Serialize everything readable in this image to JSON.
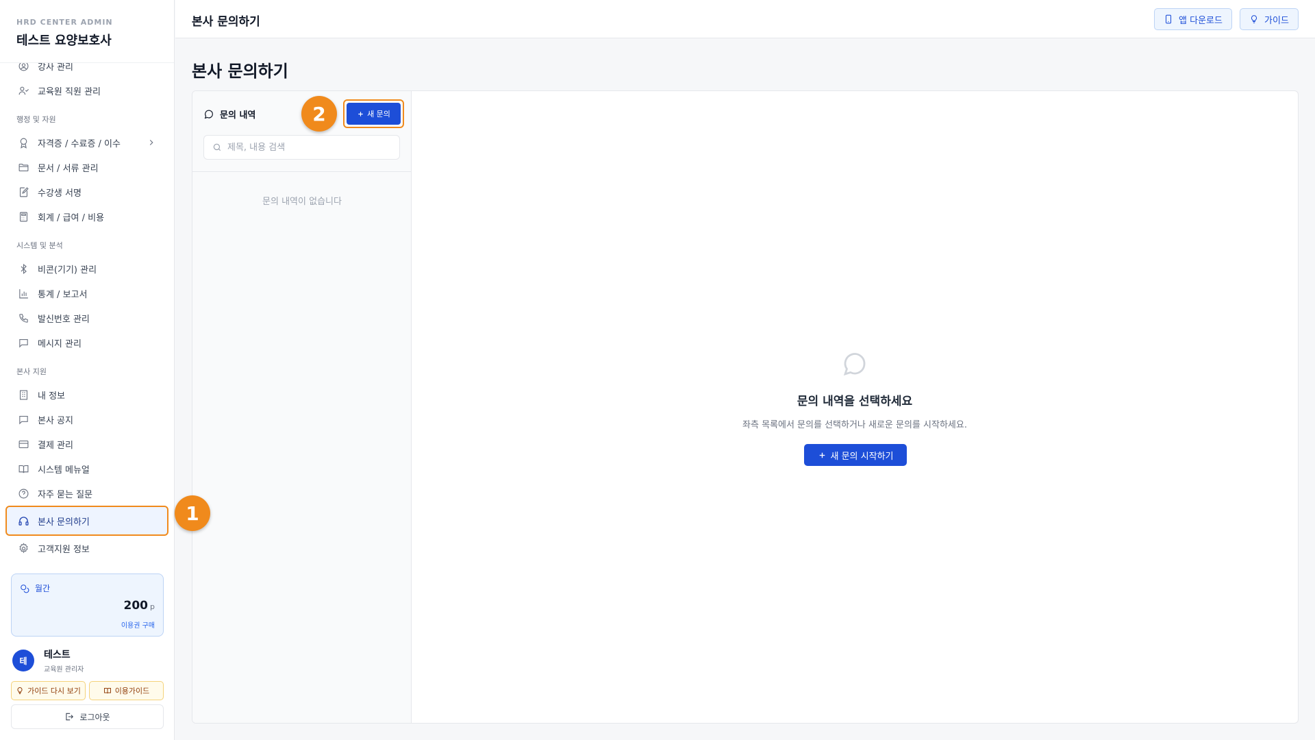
{
  "sidebar": {
    "brand_sub": "HRD CENTER ADMIN",
    "brand_title": "테스트 요양보호사",
    "items_top": [
      {
        "label": "강사 관리",
        "icon": "user-circle-icon"
      },
      {
        "label": "교육원 직원 관리",
        "icon": "users-icon"
      }
    ],
    "group_admin": "행정 및 자원",
    "items_admin": [
      {
        "label": "자격증 / 수료증 / 이수",
        "icon": "award-icon"
      },
      {
        "label": "문서 / 서류 관리",
        "icon": "folder-icon"
      },
      {
        "label": "수강생 서명",
        "icon": "signature-icon"
      },
      {
        "label": "회계 / 급여 / 비용",
        "icon": "calculator-icon"
      }
    ],
    "group_system": "시스템 및 분석",
    "items_system": [
      {
        "label": "비콘(기기) 관리",
        "icon": "bluetooth-icon"
      },
      {
        "label": "통계 / 보고서",
        "icon": "bar-chart-icon"
      },
      {
        "label": "발신번호 관리",
        "icon": "phone-icon"
      },
      {
        "label": "메시지 관리",
        "icon": "message-icon"
      }
    ],
    "group_support": "본사 지원",
    "items_support": [
      {
        "label": "내 정보",
        "icon": "building-icon"
      },
      {
        "label": "본사 공지",
        "icon": "message-icon"
      },
      {
        "label": "결제 관리",
        "icon": "credit-card-icon"
      },
      {
        "label": "시스템 메뉴얼",
        "icon": "book-icon"
      },
      {
        "label": "자주 묻는 질문",
        "icon": "help-circle-icon"
      },
      {
        "label": "본사 문의하기",
        "icon": "headset-icon",
        "active": true
      },
      {
        "label": "고객지원 정보",
        "icon": "gear-icon"
      }
    ],
    "point": {
      "label": "월간",
      "value": "200",
      "unit": "p",
      "buy": "이용권 구매"
    },
    "user": {
      "initial": "테",
      "name": "테스트",
      "role": "교육원 관리자"
    },
    "guide_again": "가이드 다시 보기",
    "usage_guide": "이용가이드",
    "logout": "로그아웃"
  },
  "header": {
    "title": "본사 문의하기",
    "app_download": "앱 다운로드",
    "guide": "가이드"
  },
  "main": {
    "page_title": "본사 문의하기",
    "list_title": "문의 내역",
    "new_button": "새 문의",
    "search_placeholder": "제목, 내용 검색",
    "empty_list": "문의 내역이 없습니다",
    "empty_title": "문의 내역을 선택하세요",
    "empty_desc": "좌측 목록에서 문의를 선택하거나 새로운 문의를 시작하세요.",
    "start_button": "새 문의 시작하기"
  },
  "badges": [
    "1",
    "2"
  ],
  "colors": {
    "accent": "#1d4ed8",
    "highlight": "#f08a1c"
  }
}
